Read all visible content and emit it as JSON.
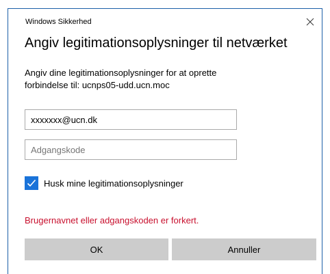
{
  "window": {
    "title": "Windows Sikkerhed",
    "close_icon": "close-icon"
  },
  "dialog": {
    "heading": "Angiv legitimationsoplysninger til netværket",
    "description_line1": "Angiv dine legitimationsoplysninger for at oprette",
    "description_line2": "forbindelse til: ucnps05-udd.ucn.moc"
  },
  "form": {
    "username_value": "xxxxxxx@ucn.dk",
    "password_value": "",
    "password_placeholder": "Adgangskode",
    "remember_label": "Husk mine legitimationsoplysninger",
    "remember_checked": true,
    "checkbox_icon": "checkmark-icon"
  },
  "error_message": "Brugernavnet eller adgangskoden er forkert.",
  "buttons": {
    "ok_label": "OK",
    "cancel_label": "Annuller"
  },
  "colors": {
    "accent": "#1a73d9",
    "window_border": "#1b5fa8",
    "error": "#c8102e",
    "button_bg": "#cccccc"
  }
}
